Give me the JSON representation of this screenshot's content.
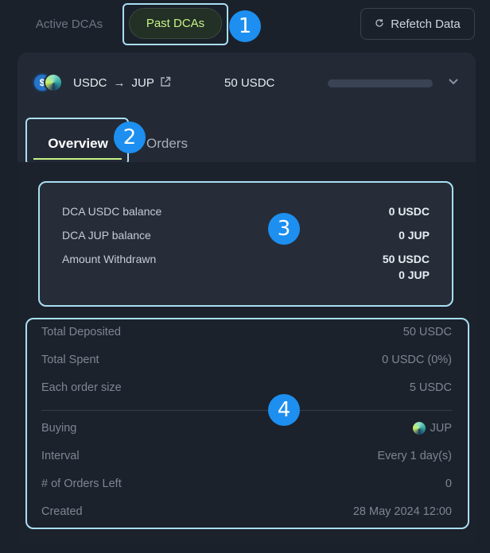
{
  "topbar": {
    "tabs": [
      {
        "label": "Active DCAs"
      },
      {
        "label": "Past DCAs"
      }
    ],
    "refetch_label": "Refetch Data"
  },
  "card": {
    "from_token": "USDC",
    "to_token": "JUP",
    "amount": "50 USDC"
  },
  "tabs": {
    "overview": "Overview",
    "orders": "Orders"
  },
  "balances": {
    "rows": [
      {
        "label": "DCA USDC balance",
        "value": "0 USDC"
      },
      {
        "label": "DCA JUP balance",
        "value": "0 JUP"
      },
      {
        "label": "Amount Withdrawn",
        "value": "50 USDC",
        "value2": "0 JUP"
      }
    ]
  },
  "details": {
    "rows": [
      {
        "label": "Total Deposited",
        "value": "50 USDC"
      },
      {
        "label": "Total Spent",
        "value": "0 USDC (0%)"
      },
      {
        "label": "Each order size",
        "value": "5 USDC"
      },
      {
        "label": "Buying",
        "value": "JUP"
      },
      {
        "label": "Interval",
        "value": "Every 1 day(s)"
      },
      {
        "label": "# of Orders Left",
        "value": "0"
      },
      {
        "label": "Created",
        "value": "28 May 2024 12:00"
      }
    ]
  },
  "annotations": [
    "1",
    "2",
    "3",
    "4"
  ],
  "colors": {
    "accent_lime": "#c7f284",
    "highlight_outline": "#a9def2",
    "badge_blue": "#1d8ff0",
    "background": "#1b212b"
  }
}
